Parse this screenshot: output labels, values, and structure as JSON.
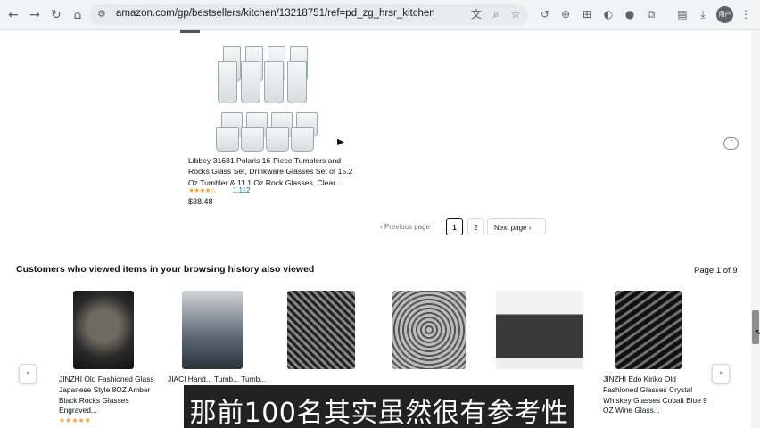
{
  "browser": {
    "url": "amazon.com/gp/bestsellers/kitchen/13218751/ref=pd_zg_hrsr_kitchen",
    "profile_initials": "用户"
  },
  "product": {
    "title": "Libbey 31631 Polaris 16-Piece Tumblers and Rocks Glass Set, Drinkware Glasses Set of 15.2 Oz Tumbler & 11.1 Oz Rock Glasses, Clear...",
    "stars": "★★★★☆",
    "rating_count": "1,112",
    "price": "$38.48"
  },
  "pagination": {
    "previous_label": "‹  Previous page",
    "pages": [
      "1",
      "2"
    ],
    "next_label": "Next page  ›"
  },
  "section": {
    "title": "Customers who viewed items in your browsing history also viewed",
    "page_indicator": "Page 1 of 9"
  },
  "carousel": {
    "prev_icon": "‹",
    "next_icon": "›",
    "items": [
      {
        "title": "JINZHI Old Fashioned Glass Japanese Style 8OZ Amber Black Rocks Glasses Engraved..."
      },
      {
        "title": "JIACI Hand... Tumb... Tumb..."
      },
      {
        "title": ""
      },
      {
        "title": ""
      },
      {
        "title": ""
      },
      {
        "title": "JINZHI Edo Kiriko Old Fashioned Glasses Crystal Whiskey Glasses Cobalt Blue 9 OZ Wine Glass..."
      }
    ]
  },
  "subtitle": "那前100名其实虽然很有参考性"
}
